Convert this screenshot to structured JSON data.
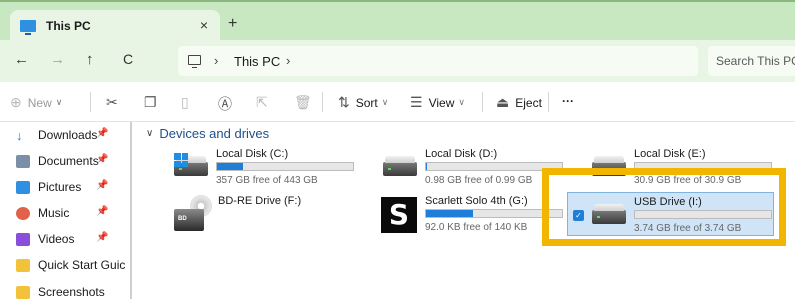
{
  "tab": {
    "title": "This PC",
    "close": "×",
    "new": "+"
  },
  "nav": {
    "back": "←",
    "forward": "→",
    "up": "↑",
    "refresh": "C"
  },
  "address": {
    "sep": "›",
    "crumb": "This PC",
    "search_placeholder": "Search This PC"
  },
  "toolbar": {
    "new_label": "New",
    "sort_label": "Sort",
    "view_label": "View",
    "eject_label": "Eject",
    "more_label": "···"
  },
  "sidebar": {
    "items": [
      {
        "label": "Downloads",
        "icon": "download-icon",
        "pinned": true
      },
      {
        "label": "Documents",
        "icon": "documents-icon",
        "pinned": true
      },
      {
        "label": "Pictures",
        "icon": "pictures-icon",
        "pinned": true
      },
      {
        "label": "Music",
        "icon": "music-icon",
        "pinned": true
      },
      {
        "label": "Videos",
        "icon": "videos-icon",
        "pinned": true
      },
      {
        "label": "Quick Start Guic",
        "icon": "folder-icon",
        "pinned": false
      },
      {
        "label": "Screenshots",
        "icon": "folder-icon",
        "pinned": false
      }
    ]
  },
  "section": {
    "title": "Devices and drives"
  },
  "drives": [
    {
      "name": "Local Disk (C:)",
      "free_text": "357 GB free of 443 GB",
      "used_fraction": 0.194,
      "icon": "windows-drive-icon"
    },
    {
      "name": "Local Disk (D:)",
      "free_text": "0.98 GB free of 0.99 GB",
      "used_fraction": 0.01,
      "icon": "hard-drive-icon"
    },
    {
      "name": "Local Disk (E:)",
      "free_text": "30.9 GB free of 30.9 GB",
      "used_fraction": 0.0,
      "icon": "hard-drive-icon"
    },
    {
      "name": "BD-RE Drive (F:)",
      "free_text": "",
      "used_fraction": null,
      "icon": "bd-drive-icon",
      "icon_text": "BD"
    },
    {
      "name": "Scarlett Solo 4th (G:)",
      "free_text": "92.0 KB free of 140 KB",
      "used_fraction": 0.343,
      "icon": "scarlett-icon",
      "icon_text": "S"
    },
    {
      "name": "USB Drive (I:)",
      "free_text": "3.74 GB free of 3.74 GB",
      "used_fraction": 0.0,
      "icon": "usb-drive-icon",
      "selected": true
    }
  ],
  "colors": {
    "highlight": "#f2b600",
    "accent": "#1f7fd8",
    "tabstrip": "#c8e8c2"
  }
}
